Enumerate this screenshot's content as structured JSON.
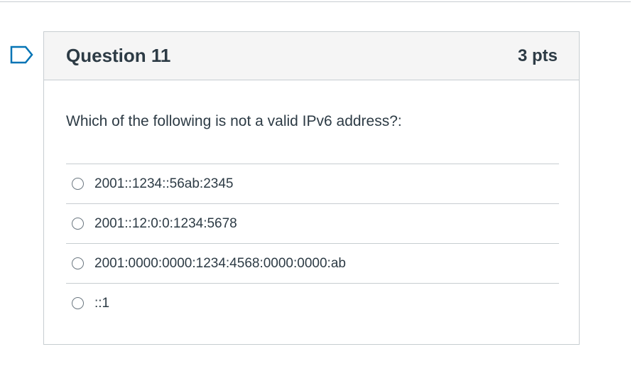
{
  "question": {
    "title": "Question 11",
    "points": "3 pts",
    "text": "Which of the following is not a valid IPv6 address?:",
    "answers": [
      {
        "label": "2001::1234::56ab:2345",
        "selected": false
      },
      {
        "label": "2001::12:0:0:1234:5678",
        "selected": false
      },
      {
        "label": "2001:0000:0000:1234:4568:0000:0000:ab",
        "selected": false
      },
      {
        "label": "::1",
        "selected": false
      }
    ]
  },
  "flag": {
    "icon": "flag-icon",
    "color": "#0374b5"
  }
}
